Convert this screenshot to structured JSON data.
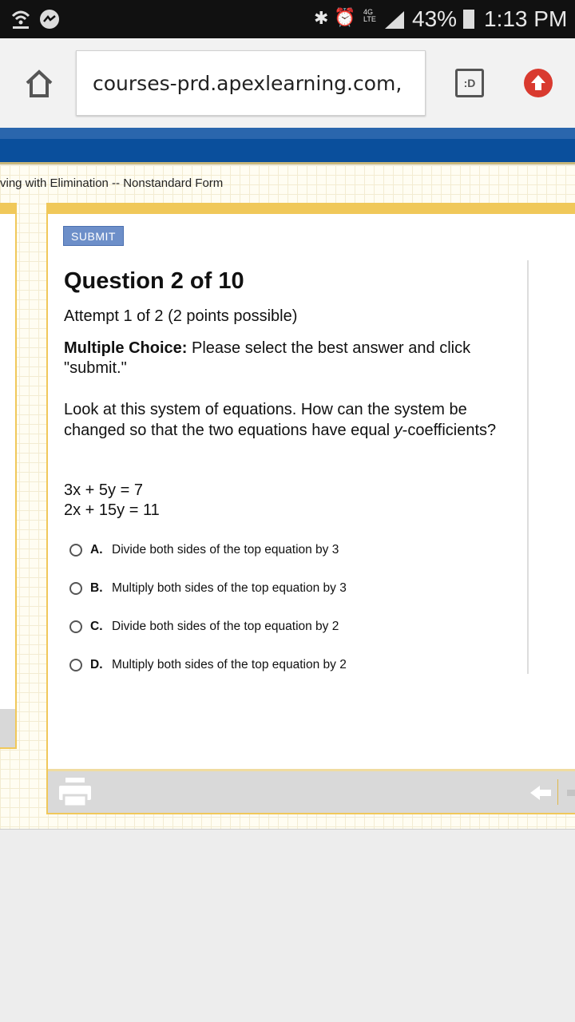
{
  "status_bar": {
    "battery": "43%",
    "time": "1:13 PM",
    "network": "4G LTE",
    "icons": [
      "wifi-hotspot-icon",
      "messenger-icon",
      "bluetooth-icon",
      "alarm-icon",
      "signal-icon",
      "battery-charging-icon"
    ]
  },
  "browser": {
    "url": "courses-prd.apexlearning.com,",
    "tab_button": ":D",
    "icons": [
      "home-icon",
      "tab-switcher-icon",
      "upload-icon"
    ]
  },
  "breadcrumb": "ving with Elimination -- Nonstandard Form",
  "quiz": {
    "submit_label": "SUBMIT",
    "title": "Question 2 of 10",
    "attempt": "Attempt 1 of 2 (2 points possible)",
    "type_label": "Multiple Choice:",
    "instructions": " Please select the best answer and click \"submit.\"",
    "prompt_a": "Look at this system of equations. How can the system be changed so that the two equations have equal ",
    "prompt_var": "y",
    "prompt_b": "-coefficients?",
    "equations": [
      "3x + 5y = 7",
      "2x + 15y = 11"
    ],
    "options": [
      {
        "letter": "A.",
        "text": "Divide both sides of the top equation by 3"
      },
      {
        "letter": "B.",
        "text": "Multiply both sides of the top equation by 3"
      },
      {
        "letter": "C.",
        "text": "Divide both sides of the top equation by 2"
      },
      {
        "letter": "D.",
        "text": "Multiply both sides of the top equation by 2"
      }
    ]
  },
  "colors": {
    "accent": "#f0c85a",
    "banner": "#0a4f9c",
    "submit": "#6d8fc9"
  }
}
